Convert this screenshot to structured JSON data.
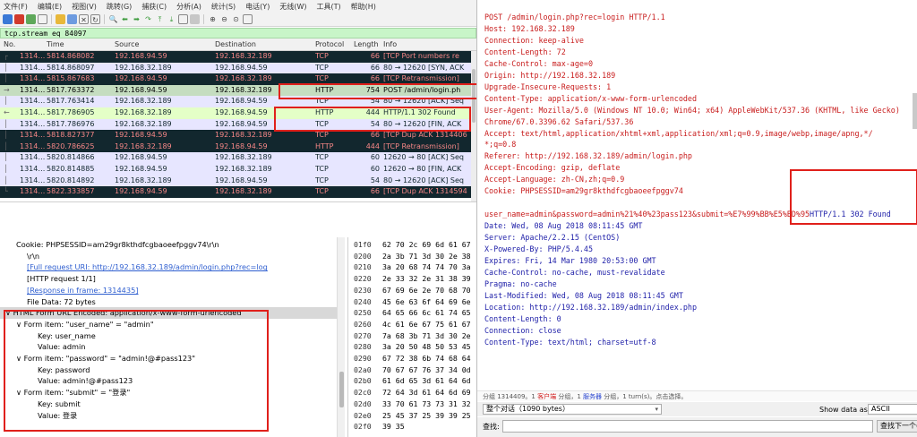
{
  "menu": [
    "文件(F)",
    "编辑(E)",
    "视图(V)",
    "跳转(G)",
    "捕获(C)",
    "分析(A)",
    "统计(S)",
    "电话(Y)",
    "无线(W)",
    "工具(T)",
    "帮助(H)"
  ],
  "filter": "tcp.stream eq 84097",
  "columns": [
    "No.",
    "Time",
    "Source",
    "Destination",
    "Protocol",
    "Length",
    "Info"
  ],
  "packets": [
    {
      "arrow": "┌",
      "no": "1314…",
      "time": "5814.868082",
      "src": "192.168.94.59",
      "dst": "192.168.32.189",
      "proto": "TCP",
      "len": "66",
      "info": "[TCP Port numbers re",
      "style": "dark"
    },
    {
      "arrow": "│",
      "no": "1314…",
      "time": "5814.868097",
      "src": "192.168.32.189",
      "dst": "192.168.94.59",
      "proto": "TCP",
      "len": "66",
      "info": "80 → 12620 [SYN, ACK",
      "style": "tcp"
    },
    {
      "arrow": "│",
      "no": "1314…",
      "time": "5815.867683",
      "src": "192.168.94.59",
      "dst": "192.168.32.189",
      "proto": "TCP",
      "len": "66",
      "info": "[TCP Retransmission]",
      "style": "dark"
    },
    {
      "arrow": "→",
      "no": "1314…",
      "time": "5817.763372",
      "src": "192.168.94.59",
      "dst": "192.168.32.189",
      "proto": "HTTP",
      "len": "754",
      "info": "POST /admin/login.ph",
      "style": "sel"
    },
    {
      "arrow": "│",
      "no": "1314…",
      "time": "5817.763414",
      "src": "192.168.32.189",
      "dst": "192.168.94.59",
      "proto": "TCP",
      "len": "54",
      "info": "80 → 12620 [ACK] Seq",
      "style": "tcp"
    },
    {
      "arrow": "←",
      "no": "1314…",
      "time": "5817.786905",
      "src": "192.168.32.189",
      "dst": "192.168.94.59",
      "proto": "HTTP",
      "len": "444",
      "info": "HTTP/1.1 302 Found",
      "style": "http"
    },
    {
      "arrow": "│",
      "no": "1314…",
      "time": "5817.786976",
      "src": "192.168.32.189",
      "dst": "192.168.94.59",
      "proto": "TCP",
      "len": "54",
      "info": "80 → 12620 [FIN, ACK",
      "style": "tcp"
    },
    {
      "arrow": "│",
      "no": "1314…",
      "time": "5818.827377",
      "src": "192.168.94.59",
      "dst": "192.168.32.189",
      "proto": "TCP",
      "len": "66",
      "info": "[TCP Dup ACK 1314406",
      "style": "dark"
    },
    {
      "arrow": "│",
      "no": "1314…",
      "time": "5820.786625",
      "src": "192.168.32.189",
      "dst": "192.168.94.59",
      "proto": "HTTP",
      "len": "444",
      "info": "[TCP Retransmission]",
      "style": "dark"
    },
    {
      "arrow": "│",
      "no": "1314…",
      "time": "5820.814866",
      "src": "192.168.94.59",
      "dst": "192.168.32.189",
      "proto": "TCP",
      "len": "60",
      "info": "12620 → 80 [ACK] Seq",
      "style": "tcp"
    },
    {
      "arrow": "│",
      "no": "1314…",
      "time": "5820.814885",
      "src": "192.168.94.59",
      "dst": "192.168.32.189",
      "proto": "TCP",
      "len": "60",
      "info": "12620 → 80 [FIN, ACK",
      "style": "tcp"
    },
    {
      "arrow": "│",
      "no": "1314…",
      "time": "5820.814892",
      "src": "192.168.32.189",
      "dst": "192.168.94.59",
      "proto": "TCP",
      "len": "54",
      "info": "80 → 12620 [ACK] Seq",
      "style": "tcp"
    },
    {
      "arrow": "└",
      "no": "1314…",
      "time": "5822.333857",
      "src": "192.168.94.59",
      "dst": "192.168.32.189",
      "proto": "TCP",
      "len": "66",
      "info": "[TCP Dup ACK 1314594",
      "style": "dark"
    }
  ],
  "details": [
    {
      "indent": 1,
      "text": "Cookie: PHPSESSID=am29gr8kthdfcgbaoeefpggv74\\r\\n",
      "type": "normal"
    },
    {
      "indent": 2,
      "text": "\\r\\n",
      "type": "normal"
    },
    {
      "indent": 2,
      "text": "[Full request URI: http://192.168.32.189/admin/login.php?rec=log",
      "type": "link"
    },
    {
      "indent": 2,
      "text": "[HTTP request 1/1]",
      "type": "normal"
    },
    {
      "indent": 2,
      "text": "[Response in frame: 1314435]",
      "type": "link"
    },
    {
      "indent": 2,
      "text": "File Data: 72 bytes",
      "type": "normal"
    },
    {
      "indent": 0,
      "text": "∨ HTML Form URL Encoded: application/x-www-form-urlencoded",
      "type": "sel"
    },
    {
      "indent": 1,
      "text": "∨ Form item: \"user_name\" = \"admin\"",
      "type": "normal"
    },
    {
      "indent": 3,
      "text": "Key: user_name",
      "type": "normal"
    },
    {
      "indent": 3,
      "text": "Value: admin",
      "type": "normal"
    },
    {
      "indent": 1,
      "text": "∨ Form item: \"password\" = \"admin!@#pass123\"",
      "type": "normal"
    },
    {
      "indent": 3,
      "text": "Key: password",
      "type": "normal"
    },
    {
      "indent": 3,
      "text": "Value: admin!@#pass123",
      "type": "normal"
    },
    {
      "indent": 1,
      "text": "∨ Form item: \"submit\" = \"登录\"",
      "type": "normal"
    },
    {
      "indent": 3,
      "text": "Key: submit",
      "type": "normal"
    },
    {
      "indent": 3,
      "text": "Value: 登录",
      "type": "normal"
    }
  ],
  "hex": [
    {
      "off": "01f0",
      "bytes": "62 70 2c 69 6d 61 67"
    },
    {
      "off": "0200",
      "bytes": "2a 3b 71 3d 30 2e 38"
    },
    {
      "off": "0210",
      "bytes": "3a 20 68 74 74 70 3a"
    },
    {
      "off": "0220",
      "bytes": "2e 33 32 2e 31 38 39"
    },
    {
      "off": "0230",
      "bytes": "67 69 6e 2e 70 68 70"
    },
    {
      "off": "0240",
      "bytes": "45 6e 63 6f 64 69 6e"
    },
    {
      "off": "0250",
      "bytes": "64 65 66 6c 61 74 65"
    },
    {
      "off": "0260",
      "bytes": "4c 61 6e 67 75 61 67"
    },
    {
      "off": "0270",
      "bytes": "7a 68 3b 71 3d 30 2e"
    },
    {
      "off": "0280",
      "bytes": "3a 20 50 48 50 53 45"
    },
    {
      "off": "0290",
      "bytes": "67 72 38 6b 74 68 64"
    },
    {
      "off": "02a0",
      "bytes": "70 67 67 76 37 34 0d"
    },
    {
      "off": "02b0",
      "bytes": "61 6d 65 3d 61 64 6d"
    },
    {
      "off": "02c0",
      "bytes": "72 64 3d 61 64 6d 69"
    },
    {
      "off": "02d0",
      "bytes": "33 70 61 73 73 31 32"
    },
    {
      "off": "02e0",
      "bytes": "25 45 37 25 39 39 25"
    },
    {
      "off": "02f0",
      "bytes": "39 35"
    }
  ],
  "stream": [
    {
      "t": "POST /admin/login.php?rec=login HTTP/1.1",
      "c": "req"
    },
    {
      "t": "Host: 192.168.32.189",
      "c": "req"
    },
    {
      "t": "Connection: keep-alive",
      "c": "req"
    },
    {
      "t": "Content-Length: 72",
      "c": "req"
    },
    {
      "t": "Cache-Control: max-age=0",
      "c": "req"
    },
    {
      "t": "Origin: http://192.168.32.189",
      "c": "req"
    },
    {
      "t": "Upgrade-Insecure-Requests: 1",
      "c": "req"
    },
    {
      "t": "Content-Type: application/x-www-form-urlencoded",
      "c": "req"
    },
    {
      "t": "User-Agent: Mozilla/5.0 (Windows NT 10.0; Win64; x64) AppleWebKit/537.36 (KHTML, like Gecko)",
      "c": "req"
    },
    {
      "t": "Chrome/67.0.3396.62 Safari/537.36",
      "c": "req"
    },
    {
      "t": "Accept: text/html,application/xhtml+xml,application/xml;q=0.9,image/webp,image/apng,*/",
      "c": "req"
    },
    {
      "t": "*;q=0.8",
      "c": "req"
    },
    {
      "t": "Referer: http://192.168.32.189/admin/login.php",
      "c": "req"
    },
    {
      "t": "Accept-Encoding: gzip, deflate",
      "c": "req"
    },
    {
      "t": "Accept-Language: zh-CN,zh;q=0.9",
      "c": "req"
    },
    {
      "t": "Cookie: PHPSESSID=am29gr8kthdfcgbaoeefpggv74",
      "c": "req"
    },
    {
      "t": "",
      "c": "req"
    },
    {
      "t": "user_name=admin&password=admin%21%40%23pass123&submit=%E7%99%BB%E5%BD%95",
      "c": "req",
      "tail": "HTTP/1.1 302 Found"
    },
    {
      "t": "Date: Wed, 08 Aug 2018 08:11:45 GMT",
      "c": "res"
    },
    {
      "t": "Server: Apache/2.2.15 (CentOS)",
      "c": "res"
    },
    {
      "t": "X-Powered-By: PHP/5.4.45",
      "c": "res"
    },
    {
      "t": "Expires: Fri, 14 Mar 1980 20:53:00 GMT",
      "c": "res"
    },
    {
      "t": "Cache-Control: no-cache, must-revalidate",
      "c": "res"
    },
    {
      "t": "Pragma: no-cache",
      "c": "res"
    },
    {
      "t": "Last-Modified: Wed, 08 Aug 2018 08:11:45 GMT",
      "c": "res"
    },
    {
      "t": "Location: http://192.168.32.189/admin/index.php",
      "c": "res"
    },
    {
      "t": "Content-Length: 0",
      "c": "res"
    },
    {
      "t": "Connection: close",
      "c": "res"
    },
    {
      "t": "Content-Type: text/html; charset=utf-8",
      "c": "res"
    }
  ],
  "status": {
    "prefix": "分组 1314409。1 ",
    "client": "客户端",
    "mid": " 分组，1 ",
    "server": "服务器",
    "suffix": " 分组，1 turn(s)。点击选择。"
  },
  "conversation_select": "整个对话（1090 bytes）",
  "show_data_label": "Show data as",
  "show_data_value": "ASCII",
  "find_label": "查找:",
  "find_next": "查找下一个(N)",
  "colors": {
    "request": "#c81c1c",
    "response": "#1d1ea8",
    "annotation": "#e0201b",
    "filter_bg": "#c8f5c8"
  }
}
